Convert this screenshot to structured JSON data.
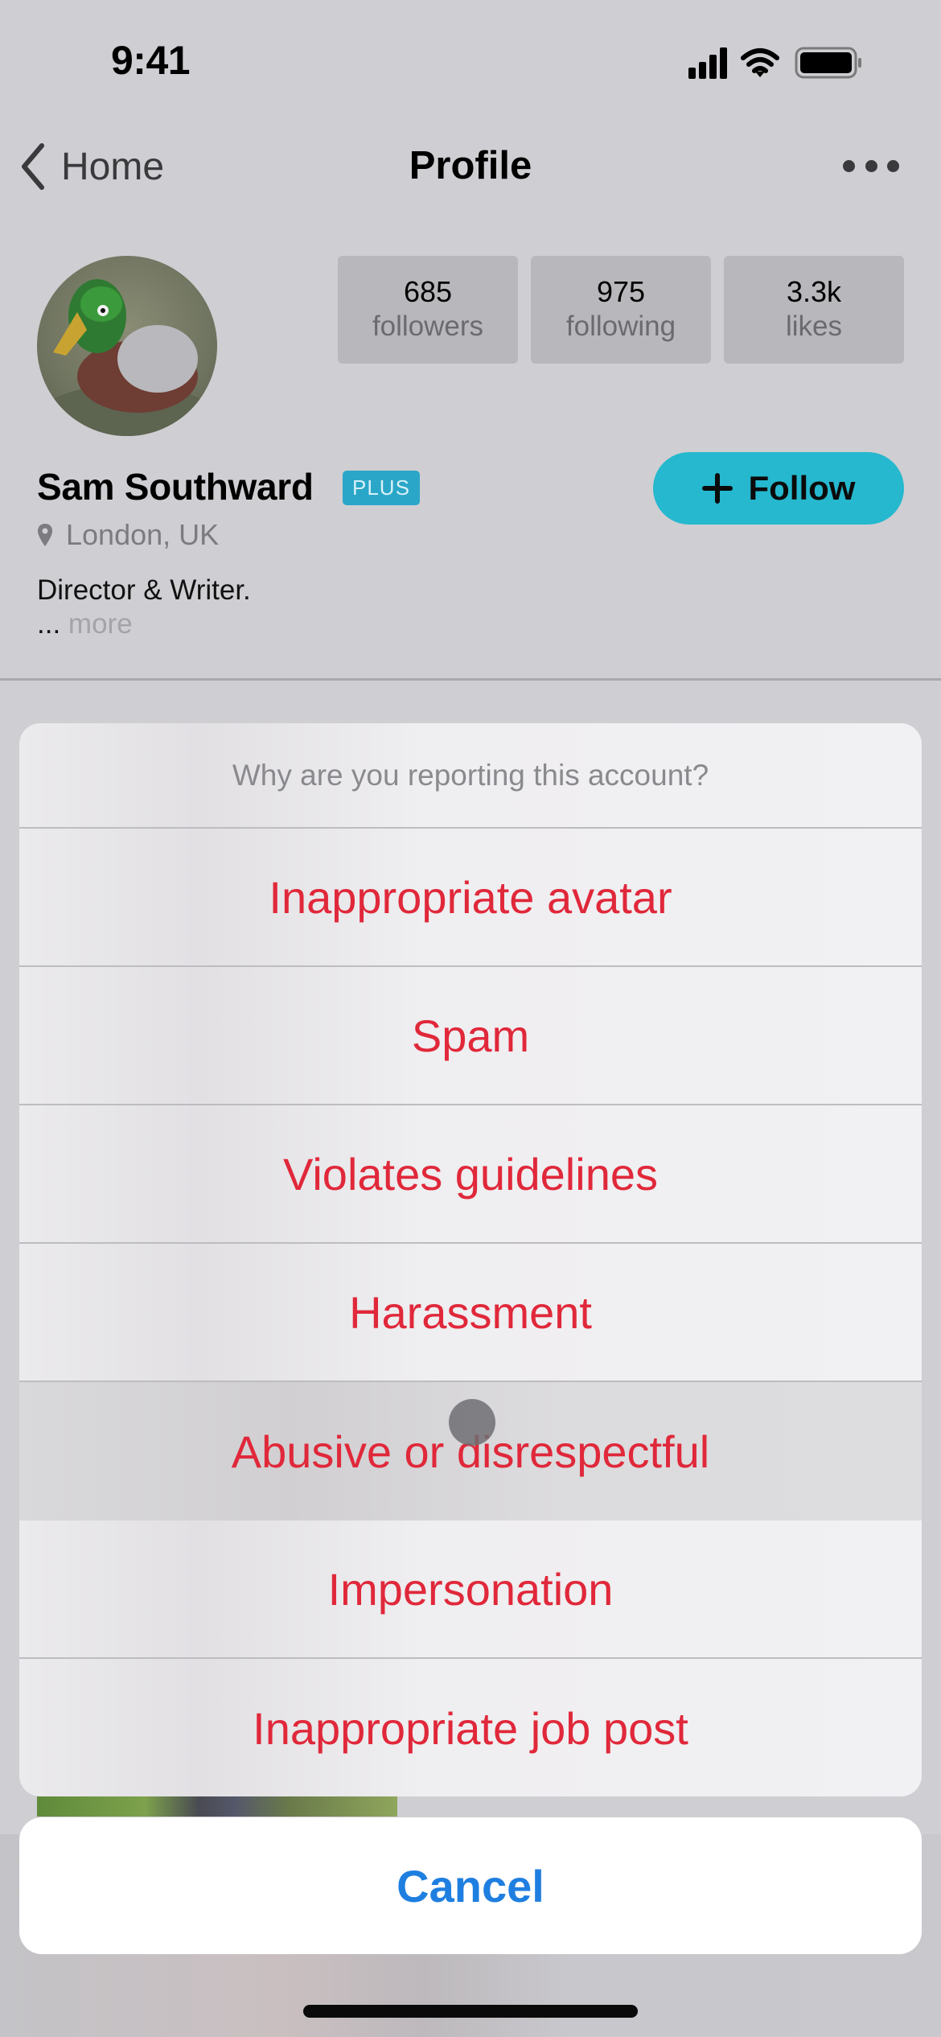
{
  "status_bar": {
    "time": "9:41"
  },
  "nav": {
    "back_label": "Home",
    "title": "Profile"
  },
  "profile": {
    "name": "Sam Southward",
    "badge": "PLUS",
    "location": "London, UK",
    "bio": "Director & Writer.",
    "ellipsis": "...",
    "more_label": "more",
    "follow_label": "Follow",
    "stats": [
      {
        "value": "685",
        "label": "followers"
      },
      {
        "value": "975",
        "label": "following"
      },
      {
        "value": "3.3k",
        "label": "likes"
      }
    ]
  },
  "action_sheet": {
    "title": "Why are you reporting this account?",
    "options": [
      "Inappropriate avatar",
      "Spam",
      "Violates guidelines",
      "Harassment",
      "Abusive or disrespectful",
      "Impersonation",
      "Inappropriate job post"
    ],
    "pressed_option": "Abusive or disrespectful",
    "cancel_label": "Cancel"
  },
  "colors": {
    "destructive": "#e0283a",
    "cancel": "#1f7fe0",
    "follow": "#25b8cf",
    "badge": "#2aa6c8"
  }
}
